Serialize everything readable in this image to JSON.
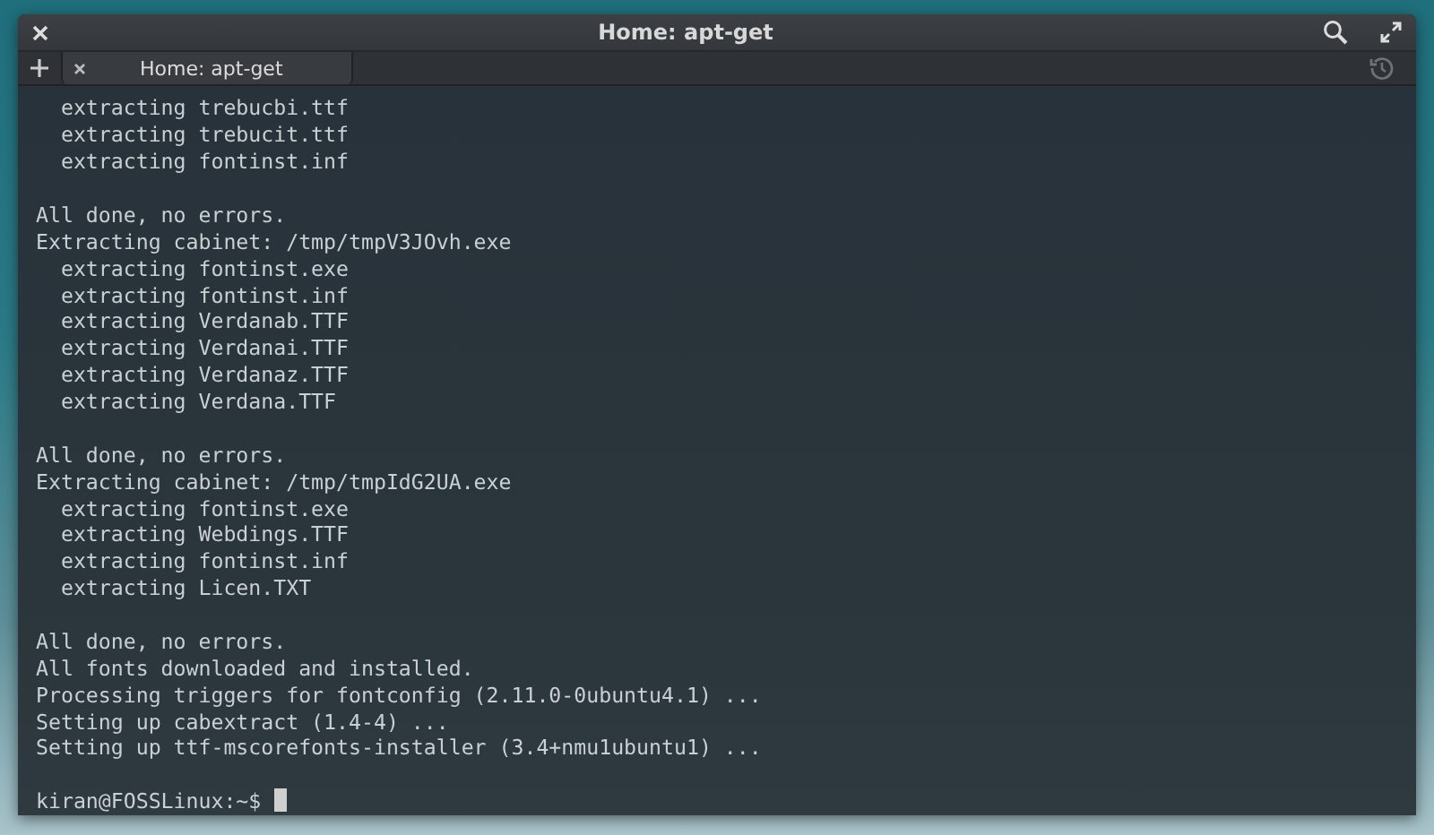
{
  "window": {
    "title": "Home: apt-get"
  },
  "tabs": [
    {
      "label": "Home: apt-get",
      "selected": true
    }
  ],
  "terminal": {
    "blocks": [
      [
        "  extracting trebucbi.ttf",
        "  extracting trebucit.ttf",
        "  extracting fontinst.inf"
      ],
      [
        "All done, no errors.",
        "Extracting cabinet: /tmp/tmpV3JOvh.exe",
        "  extracting fontinst.exe",
        "  extracting fontinst.inf",
        "  extracting Verdanab.TTF",
        "  extracting Verdanai.TTF",
        "  extracting Verdanaz.TTF",
        "  extracting Verdana.TTF"
      ],
      [
        "All done, no errors.",
        "Extracting cabinet: /tmp/tmpIdG2UA.exe",
        "  extracting fontinst.exe",
        "  extracting Webdings.TTF",
        "  extracting fontinst.inf",
        "  extracting Licen.TXT"
      ],
      [
        "All done, no errors.",
        "All fonts downloaded and installed.",
        "Processing triggers for fontconfig (2.11.0-0ubuntu4.1) ...",
        "Setting up cabextract (1.4-4) ...",
        "Setting up ttf-mscorefonts-installer (3.4+nmu1ubuntu1) ..."
      ]
    ],
    "prompt": {
      "text": "kiran@FOSSLinux:~$ ",
      "cursor": true
    }
  }
}
